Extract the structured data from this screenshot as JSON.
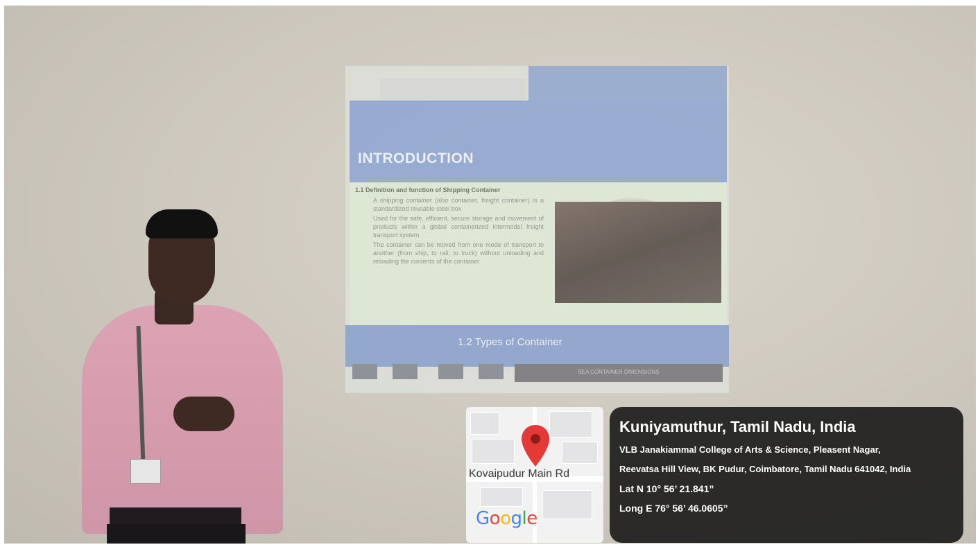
{
  "slide": {
    "title": "INTRODUCTION",
    "subheading": "1.1 Definition and function of Shipping Container",
    "bullets": [
      "A shipping container (also container, freight container) is a standardized reusable steel box",
      "Used for the safe, efficient, secure storage and movement of products within a global containerized intermodel freight transport system",
      "The container can be moved from one mode of transport to another (from ship, to rail, to truck) without unloading and reloading the contents of the container"
    ],
    "footer_title": "1.2 Types of Container",
    "footer_table_label": "SEA CONTAINER DIMENSIONS"
  },
  "map": {
    "road_label": "Kovaipudur Main Rd",
    "logo_text": "Google",
    "pin_color": "#e53935"
  },
  "location": {
    "title": "Kuniyamuthur, Tamil Nadu, India",
    "address_line1": "VLB Janakiammal College of Arts & Science, Pleasent Nagar,",
    "address_line2": "Reevatsa Hill View, BK Pudur, Coimbatore, Tamil Nadu 641042, India",
    "latitude": "Lat N 10° 56’ 21.841”",
    "longitude": "Long E 76° 56’ 46.0605”"
  },
  "colors": {
    "slide_header": "#93a9d2",
    "slide_body": "#dfe9d6",
    "shirt": "#dca3b4",
    "info_card": "#141414"
  }
}
